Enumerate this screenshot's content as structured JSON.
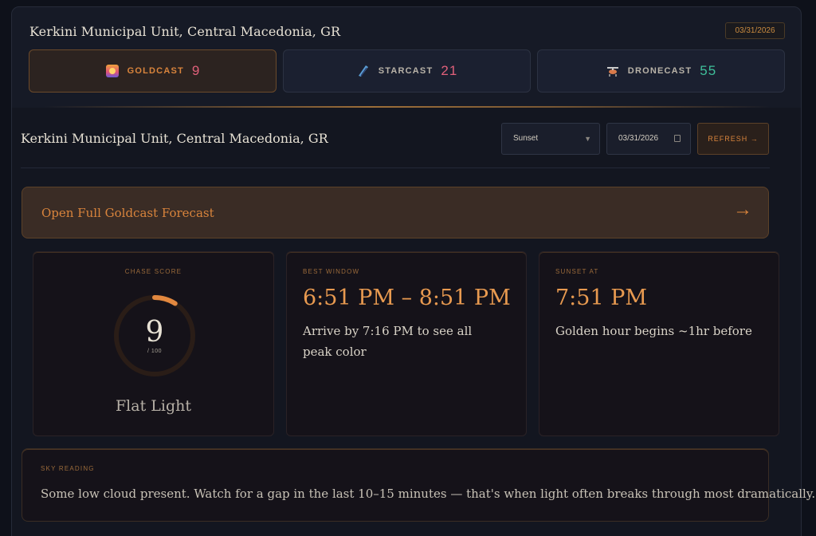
{
  "header": {
    "location": "Kerkini Municipal Unit, Central Macedonia, GR",
    "date": "03/31/2026"
  },
  "tabs": [
    {
      "label": "GOLDCAST",
      "count": "9",
      "icon": "sunset-icon",
      "color": "#e0607a",
      "active": true
    },
    {
      "label": "STARCAST",
      "count": "21",
      "icon": "galaxy-icon",
      "color": "#e0607a",
      "active": false
    },
    {
      "label": "DRONECAST",
      "count": "55",
      "icon": "drone-icon",
      "color": "#3fbf9a",
      "active": false
    }
  ],
  "controls": {
    "location": "Kerkini Municipal Unit, Central Macedonia, GR",
    "event_select": "Sunset",
    "date_value": "03/31/2026",
    "refresh_label": "REFRESH →"
  },
  "banner": {
    "label": "Open Full Goldcast Forecast",
    "arrow": "→"
  },
  "chase": {
    "label": "CHASE SCORE",
    "score": "9",
    "out_of": "/ 100",
    "score_value": 9,
    "max": 100,
    "verdict": "Flat Light"
  },
  "best_window": {
    "label": "BEST WINDOW",
    "time": "6:51 PM – 8:51 PM",
    "note": "Arrive by 7:16 PM to see all peak color"
  },
  "sunset": {
    "label": "SUNSET AT",
    "time": "7:51 PM",
    "note": "Golden hour begins ~1hr before"
  },
  "sky": {
    "label": "SKY READING",
    "text": "Some low cloud present. Watch for a gap in the last 10–15 minutes — that's when light often breaks through most dramatically."
  },
  "colors": {
    "accent": "#d9843c",
    "background": "#0e111a"
  }
}
